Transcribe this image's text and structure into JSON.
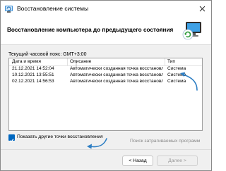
{
  "window": {
    "title": "Восстановление системы"
  },
  "header": {
    "title": "Восстановление компьютера до предыдущего состояния"
  },
  "timezone_text": "Текущий часовой пояс: GMT+3:00",
  "table": {
    "columns": [
      "Дата и время",
      "Описание",
      "Тип"
    ],
    "rows": [
      {
        "date": "21.12.2021 14:52:04",
        "description": "Автоматически созданная точка восстановле...",
        "type": "Система"
      },
      {
        "date": "10.12.2021 13:55:51",
        "description": "Автоматически созданная точка восстановле...",
        "type": "Система"
      },
      {
        "date": "02.12.2021 14:56:53",
        "description": "Автоматически созданная точка восстановле...",
        "type": "Система"
      }
    ]
  },
  "checkbox": {
    "label": "Показать другие точки восстановления",
    "checked": true
  },
  "scan_link": "Поиск затрагиваемых программ",
  "buttons": {
    "back": "< Назад",
    "next": "Далее >"
  },
  "colors": {
    "accent": "#0067c0",
    "annotation_arrow": "#2f7fc4"
  }
}
